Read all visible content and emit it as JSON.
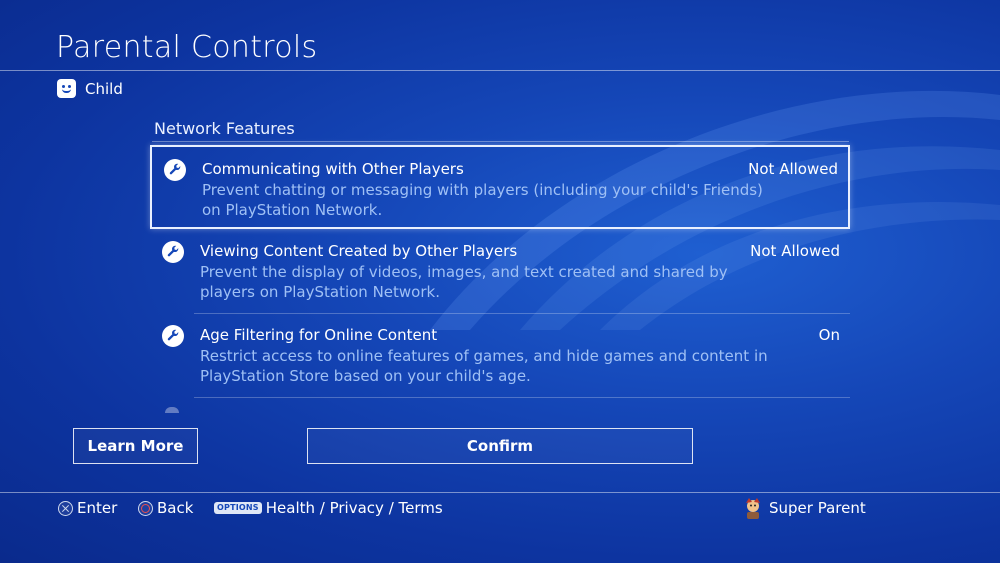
{
  "header": {
    "title": "Parental Controls"
  },
  "user": {
    "name": "Child",
    "icon": "smiley-face-icon"
  },
  "section": {
    "title": "Network Features"
  },
  "items": [
    {
      "title": "Communicating with Other Players",
      "value": "Not Allowed",
      "description": "Prevent chatting or messaging with players (including your child's Friends) on PlayStation Network.",
      "icon": "wrench-icon",
      "focused": true
    },
    {
      "title": "Viewing Content Created by Other Players",
      "value": "Not Allowed",
      "description": "Prevent the display of videos, images, and text created and shared by players on PlayStation Network.",
      "icon": "wrench-icon",
      "focused": false
    },
    {
      "title": "Age Filtering for Online Content",
      "value": "On",
      "description": "Restrict access to online features of games, and hide games and content in PlayStation Store based on your child's age.",
      "icon": "wrench-icon",
      "focused": false
    }
  ],
  "buttons": {
    "learn_more": "Learn More",
    "confirm": "Confirm"
  },
  "footer": {
    "enter": "Enter",
    "back": "Back",
    "options_key": "OPTIONS",
    "links": "Health / Privacy / Terms",
    "account_name": "Super Parent"
  },
  "colors": {
    "background": "#1547b8",
    "description_text": "#9fc0f5",
    "focus_border": "#e9f0ff"
  }
}
